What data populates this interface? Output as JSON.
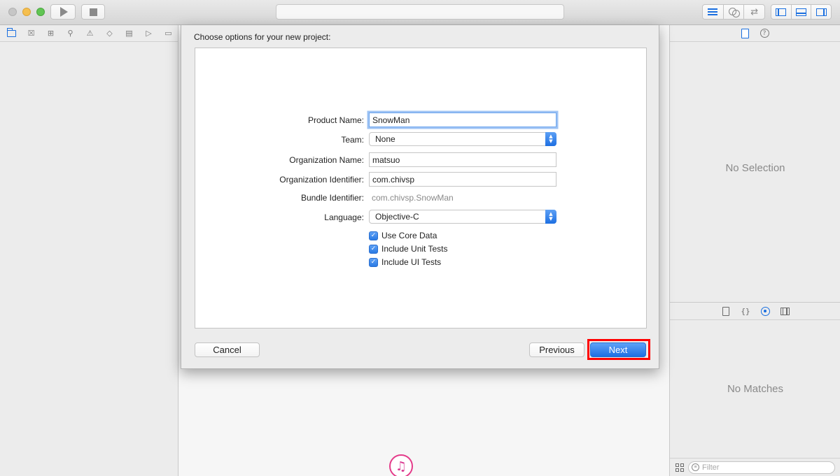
{
  "toolbar": {
    "run_icon": "play-icon",
    "stop_icon": "stop-icon",
    "activity_text": "",
    "editor_icons": [
      "standard-editor-icon",
      "assistant-editor-icon",
      "version-editor-icon"
    ],
    "view_icons": [
      "navigator-toggle-icon",
      "debug-area-toggle-icon",
      "utilities-toggle-icon"
    ]
  },
  "navigator": {
    "icons": [
      "project-navigator-icon",
      "symbol-navigator-icon",
      "hierarchy-navigator-icon",
      "find-navigator-icon",
      "issue-navigator-icon",
      "test-navigator-icon",
      "debug-navigator-icon",
      "breakpoint-navigator-icon",
      "report-navigator-icon"
    ],
    "glyphs": [
      "",
      "☒",
      "⊞",
      "⚲",
      "⚠",
      "◇",
      "▤",
      "▷",
      "▭"
    ]
  },
  "dialog": {
    "title": "Choose options for your new project:",
    "fields": {
      "product_name": {
        "label": "Product Name:",
        "value": "SnowMan"
      },
      "team": {
        "label": "Team:",
        "value": "None"
      },
      "organization_name": {
        "label": "Organization Name:",
        "value": "matsuo"
      },
      "organization_identifier": {
        "label": "Organization Identifier:",
        "value": "com.chivsp"
      },
      "bundle_identifier": {
        "label": "Bundle Identifier:",
        "value": "com.chivsp.SnowMan"
      },
      "language": {
        "label": "Language:",
        "value": "Objective-C"
      }
    },
    "checkboxes": {
      "core_data": {
        "label": "Use Core Data",
        "checked": true
      },
      "unit_tests": {
        "label": "Include Unit Tests",
        "checked": true
      },
      "ui_tests": {
        "label": "Include UI Tests",
        "checked": true
      }
    },
    "buttons": {
      "cancel": "Cancel",
      "previous": "Previous",
      "next": "Next"
    },
    "highlight_color": "#ff0000"
  },
  "inspector": {
    "no_selection": "No Selection",
    "no_matches": "No Matches",
    "filter_placeholder": "Filter",
    "lib_glyph_code": "{}"
  },
  "colors": {
    "accent": "#1a6fe0",
    "highlight": "#ff0000"
  }
}
